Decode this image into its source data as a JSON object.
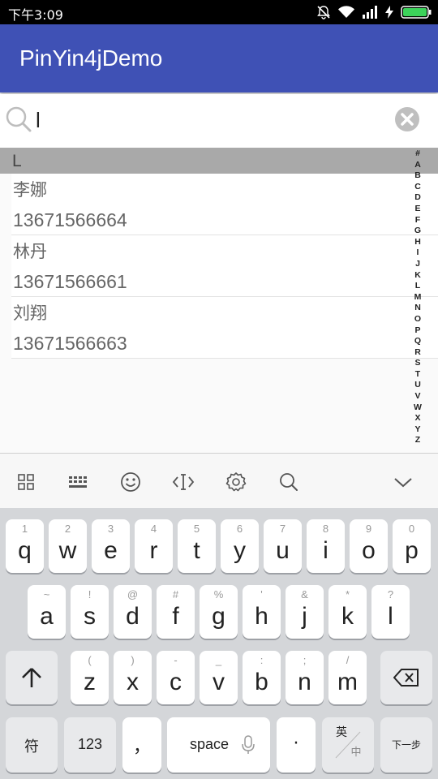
{
  "status_bar": {
    "time": "下午3:09",
    "icons": [
      "mute-icon",
      "wifi-icon",
      "signal-icon",
      "charging-icon",
      "battery-icon"
    ]
  },
  "app_bar": {
    "title": "PinYin4jDemo",
    "color": "#3f51b5"
  },
  "search": {
    "value": "l",
    "placeholder": ""
  },
  "list": {
    "section": "L",
    "contacts": [
      {
        "name": "李娜",
        "phone": "13671566664"
      },
      {
        "name": "林丹",
        "phone": "13671566661"
      },
      {
        "name": "刘翔",
        "phone": "13671566663"
      }
    ]
  },
  "index_bar": [
    "#",
    "A",
    "B",
    "C",
    "D",
    "E",
    "F",
    "G",
    "H",
    "I",
    "J",
    "K",
    "L",
    "M",
    "N",
    "O",
    "P",
    "Q",
    "R",
    "S",
    "T",
    "U",
    "V",
    "W",
    "X",
    "Y",
    "Z"
  ],
  "keyboard_toolbar": [
    "grid-icon",
    "keyboard-icon",
    "emoji-icon",
    "cursor-icon",
    "settings-icon",
    "search-icon",
    "chevron-down-icon"
  ],
  "keyboard": {
    "row1": [
      {
        "key": "q",
        "sub": "1"
      },
      {
        "key": "w",
        "sub": "2"
      },
      {
        "key": "e",
        "sub": "3"
      },
      {
        "key": "r",
        "sub": "4"
      },
      {
        "key": "t",
        "sub": "5"
      },
      {
        "key": "y",
        "sub": "6"
      },
      {
        "key": "u",
        "sub": "7"
      },
      {
        "key": "i",
        "sub": "8"
      },
      {
        "key": "o",
        "sub": "9"
      },
      {
        "key": "p",
        "sub": "0"
      }
    ],
    "row2": [
      {
        "key": "a",
        "sub": "~"
      },
      {
        "key": "s",
        "sub": "!"
      },
      {
        "key": "d",
        "sub": "@"
      },
      {
        "key": "f",
        "sub": "#"
      },
      {
        "key": "g",
        "sub": "%"
      },
      {
        "key": "h",
        "sub": "'"
      },
      {
        "key": "j",
        "sub": "&"
      },
      {
        "key": "k",
        "sub": "*"
      },
      {
        "key": "l",
        "sub": "?"
      }
    ],
    "row3": [
      {
        "key": "z",
        "sub": "("
      },
      {
        "key": "x",
        "sub": ")"
      },
      {
        "key": "c",
        "sub": "-"
      },
      {
        "key": "v",
        "sub": "_"
      },
      {
        "key": "b",
        "sub": ":"
      },
      {
        "key": "n",
        "sub": ";"
      },
      {
        "key": "m",
        "sub": "/"
      }
    ],
    "symbols_label": "符",
    "numbers_label": "123",
    "comma_label": "，",
    "space_label": "space",
    "period_label": "·",
    "lang_top": "英",
    "lang_bottom": "中",
    "next_label": "下一步"
  }
}
